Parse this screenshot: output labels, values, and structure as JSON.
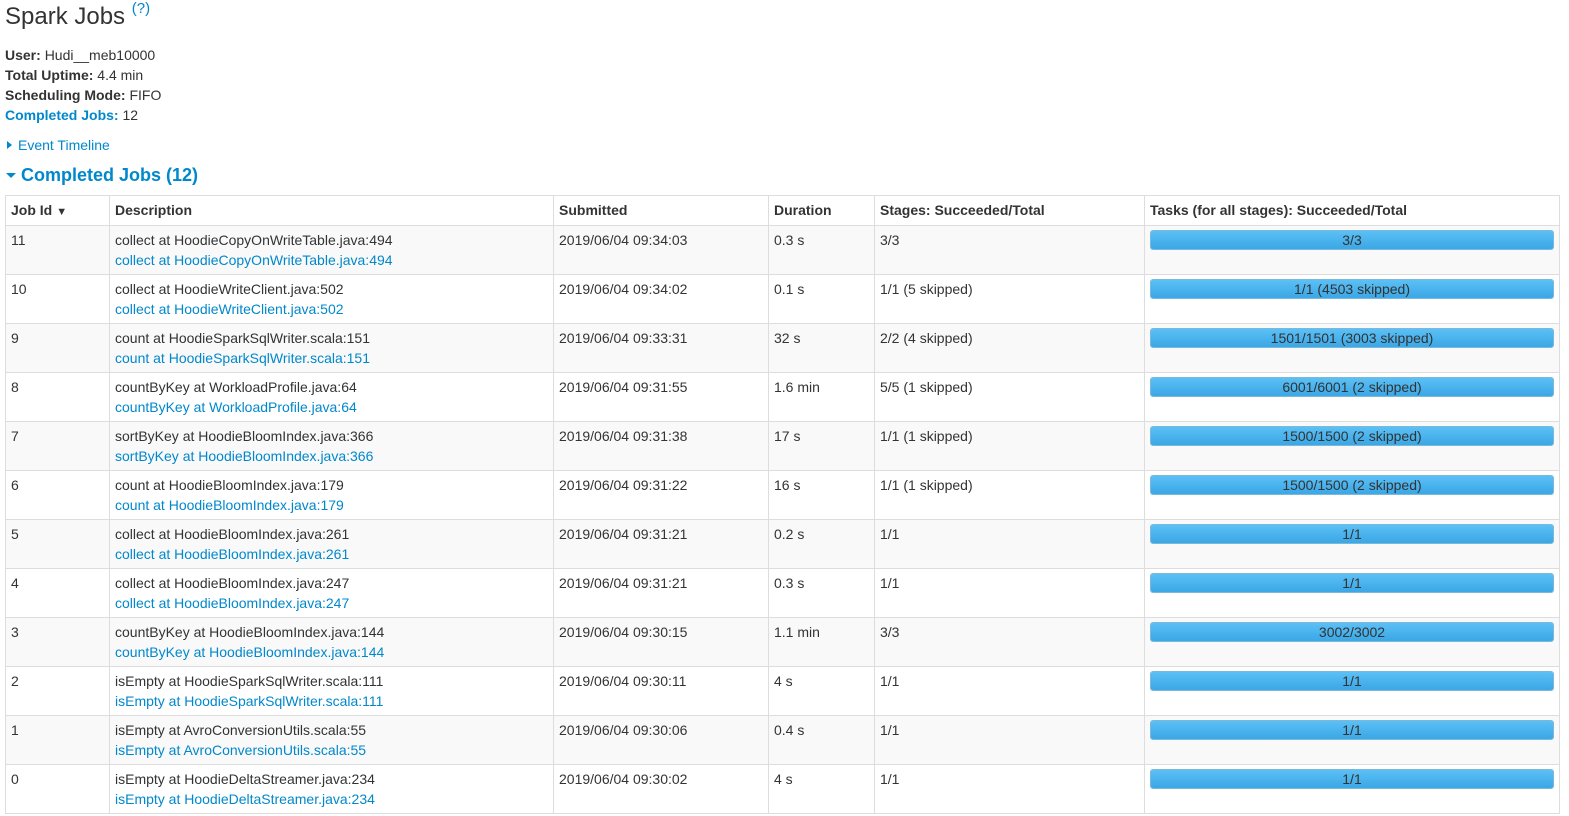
{
  "header": {
    "title": "Spark Jobs",
    "help_link": "(?)"
  },
  "summary": {
    "user_label": "User:",
    "user_value": "Hudi__meb10000",
    "uptime_label": "Total Uptime:",
    "uptime_value": "4.4 min",
    "mode_label": "Scheduling Mode:",
    "mode_value": "FIFO",
    "completed_label": "Completed Jobs:",
    "completed_value": "12"
  },
  "event_timeline": {
    "label": "Event Timeline"
  },
  "completed_section": {
    "label": "Completed Jobs (12)"
  },
  "table": {
    "headers": {
      "job_id": "Job Id",
      "sort_indicator": "▼",
      "description": "Description",
      "submitted": "Submitted",
      "duration": "Duration",
      "stages": "Stages: Succeeded/Total",
      "tasks": "Tasks (for all stages): Succeeded/Total"
    },
    "rows": [
      {
        "id": "11",
        "desc": "collect at HoodieCopyOnWriteTable.java:494",
        "link": "collect at HoodieCopyOnWriteTable.java:494",
        "submitted": "2019/06/04 09:34:03",
        "duration": "0.3 s",
        "stages": "3/3",
        "tasks": "3/3",
        "progress": 1.0
      },
      {
        "id": "10",
        "desc": "collect at HoodieWriteClient.java:502",
        "link": "collect at HoodieWriteClient.java:502",
        "submitted": "2019/06/04 09:34:02",
        "duration": "0.1 s",
        "stages": "1/1 (5 skipped)",
        "tasks": "1/1 (4503 skipped)",
        "progress": 1.0
      },
      {
        "id": "9",
        "desc": "count at HoodieSparkSqlWriter.scala:151",
        "link": "count at HoodieSparkSqlWriter.scala:151",
        "submitted": "2019/06/04 09:33:31",
        "duration": "32 s",
        "stages": "2/2 (4 skipped)",
        "tasks": "1501/1501 (3003 skipped)",
        "progress": 1.0
      },
      {
        "id": "8",
        "desc": "countByKey at WorkloadProfile.java:64",
        "link": "countByKey at WorkloadProfile.java:64",
        "submitted": "2019/06/04 09:31:55",
        "duration": "1.6 min",
        "stages": "5/5 (1 skipped)",
        "tasks": "6001/6001 (2 skipped)",
        "progress": 1.0
      },
      {
        "id": "7",
        "desc": "sortByKey at HoodieBloomIndex.java:366",
        "link": "sortByKey at HoodieBloomIndex.java:366",
        "submitted": "2019/06/04 09:31:38",
        "duration": "17 s",
        "stages": "1/1 (1 skipped)",
        "tasks": "1500/1500 (2 skipped)",
        "progress": 1.0
      },
      {
        "id": "6",
        "desc": "count at HoodieBloomIndex.java:179",
        "link": "count at HoodieBloomIndex.java:179",
        "submitted": "2019/06/04 09:31:22",
        "duration": "16 s",
        "stages": "1/1 (1 skipped)",
        "tasks": "1500/1500 (2 skipped)",
        "progress": 1.0
      },
      {
        "id": "5",
        "desc": "collect at HoodieBloomIndex.java:261",
        "link": "collect at HoodieBloomIndex.java:261",
        "submitted": "2019/06/04 09:31:21",
        "duration": "0.2 s",
        "stages": "1/1",
        "tasks": "1/1",
        "progress": 1.0
      },
      {
        "id": "4",
        "desc": "collect at HoodieBloomIndex.java:247",
        "link": "collect at HoodieBloomIndex.java:247",
        "submitted": "2019/06/04 09:31:21",
        "duration": "0.3 s",
        "stages": "1/1",
        "tasks": "1/1",
        "progress": 1.0
      },
      {
        "id": "3",
        "desc": "countByKey at HoodieBloomIndex.java:144",
        "link": "countByKey at HoodieBloomIndex.java:144",
        "submitted": "2019/06/04 09:30:15",
        "duration": "1.1 min",
        "stages": "3/3",
        "tasks": "3002/3002",
        "progress": 1.0
      },
      {
        "id": "2",
        "desc": "isEmpty at HoodieSparkSqlWriter.scala:111",
        "link": "isEmpty at HoodieSparkSqlWriter.scala:111",
        "submitted": "2019/06/04 09:30:11",
        "duration": "4 s",
        "stages": "1/1",
        "tasks": "1/1",
        "progress": 1.0
      },
      {
        "id": "1",
        "desc": "isEmpty at AvroConversionUtils.scala:55",
        "link": "isEmpty at AvroConversionUtils.scala:55",
        "submitted": "2019/06/04 09:30:06",
        "duration": "0.4 s",
        "stages": "1/1",
        "tasks": "1/1",
        "progress": 1.0
      },
      {
        "id": "0",
        "desc": "isEmpty at HoodieDeltaStreamer.java:234",
        "link": "isEmpty at HoodieDeltaStreamer.java:234",
        "submitted": "2019/06/04 09:30:02",
        "duration": "4 s",
        "stages": "1/1",
        "tasks": "1/1",
        "progress": 1.0
      }
    ]
  },
  "colors": {
    "link": "#0088cc",
    "progress_bar": "#3ba7e6"
  }
}
